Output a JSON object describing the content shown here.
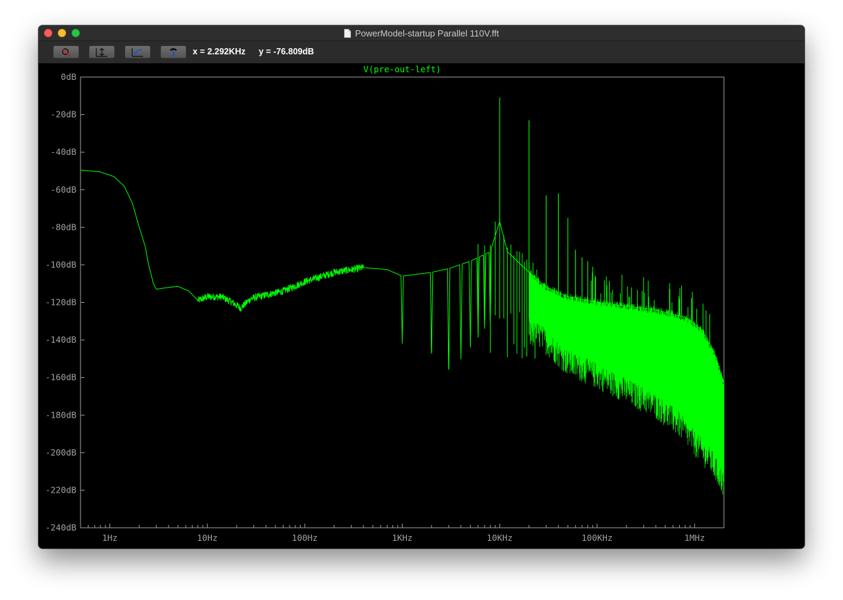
{
  "window": {
    "title": "PowerModel-startup Parallel 110V.fft"
  },
  "toolbar": {
    "buttons": [
      {
        "name": "zoom-cancel-button",
        "icon": "magnifier-cancel-icon"
      },
      {
        "name": "autorange-button",
        "icon": "autorange-icon"
      },
      {
        "name": "zoom-back-button",
        "icon": "zoom-back-icon"
      },
      {
        "name": "probe-button",
        "icon": "probe-icon"
      }
    ],
    "cursor_x": "x = 2.292KHz",
    "cursor_y": "y = -76.809dB"
  },
  "plot": {
    "trace_label": "V(pre-out-left)",
    "trace_color": "#00ff00",
    "axis_color": "#a0a0a0",
    "grid": false
  },
  "chart_data": {
    "type": "line",
    "title": "V(pre-out-left)",
    "xlabel": "",
    "ylabel": "",
    "x_scale": "log",
    "xlim": [
      0.5,
      2000000
    ],
    "ylim": [
      -240,
      0
    ],
    "x_ticks": [
      {
        "value": 1,
        "label": "1Hz"
      },
      {
        "value": 10,
        "label": "10Hz"
      },
      {
        "value": 100,
        "label": "100Hz"
      },
      {
        "value": 1000,
        "label": "1KHz"
      },
      {
        "value": 10000,
        "label": "10KHz"
      },
      {
        "value": 100000,
        "label": "100KHz"
      },
      {
        "value": 1000000,
        "label": "1MHz"
      }
    ],
    "y_ticks": [
      {
        "value": 0,
        "label": "0dB"
      },
      {
        "value": -20,
        "label": "-20dB"
      },
      {
        "value": -40,
        "label": "-40dB"
      },
      {
        "value": -60,
        "label": "-60dB"
      },
      {
        "value": -80,
        "label": "-80dB"
      },
      {
        "value": -100,
        "label": "-100dB"
      },
      {
        "value": -120,
        "label": "-120dB"
      },
      {
        "value": -140,
        "label": "-140dB"
      },
      {
        "value": -160,
        "label": "-160dB"
      },
      {
        "value": -180,
        "label": "-180dB"
      },
      {
        "value": -200,
        "label": "-200dB"
      },
      {
        "value": -220,
        "label": "-220dB"
      },
      {
        "value": -240,
        "label": "-240dB"
      }
    ],
    "series": [
      {
        "name": "V(pre-out-left)",
        "color": "#00ff00",
        "envelope": [
          [
            0.5,
            -49.5
          ],
          [
            0.8,
            -50.5
          ],
          [
            1.1,
            -53
          ],
          [
            1.4,
            -58
          ],
          [
            1.7,
            -67
          ],
          [
            2.0,
            -80
          ],
          [
            2.3,
            -90
          ],
          [
            2.5,
            -100
          ],
          [
            2.8,
            -110
          ],
          [
            3.0,
            -113
          ],
          [
            4.0,
            -112
          ],
          [
            5.0,
            -111.5
          ],
          [
            6.5,
            -114
          ],
          [
            8.0,
            -119
          ],
          [
            10,
            -117
          ],
          [
            14,
            -117
          ],
          [
            18,
            -120
          ],
          [
            22,
            -123
          ],
          [
            28,
            -118
          ],
          [
            40,
            -116
          ],
          [
            60,
            -114
          ],
          [
            100,
            -109
          ],
          [
            200,
            -104
          ],
          [
            400,
            -101.5
          ],
          [
            700,
            -102.5
          ],
          [
            1000,
            -106
          ],
          [
            2000,
            -104
          ],
          [
            3000,
            -102
          ],
          [
            5000,
            -98
          ],
          [
            8000,
            -93
          ],
          [
            10000,
            -77
          ],
          [
            12000,
            -93
          ],
          [
            20000,
            -104
          ],
          [
            30000,
            -112
          ],
          [
            50000,
            -117
          ],
          [
            100000,
            -120
          ],
          [
            200000,
            -122
          ],
          [
            400000,
            -124
          ],
          [
            800000,
            -128
          ],
          [
            1200000,
            -135
          ],
          [
            1600000,
            -147
          ],
          [
            2000000,
            -163
          ]
        ],
        "notches": [
          [
            1000,
            -142
          ],
          [
            2000,
            -152
          ],
          [
            3000,
            -162
          ],
          [
            4000,
            -152
          ],
          [
            5000,
            -145
          ],
          [
            6000,
            -140
          ],
          [
            7000,
            -136
          ],
          [
            8000,
            -133
          ]
        ],
        "spikes": [
          [
            10000,
            -11
          ],
          [
            20000,
            -23
          ],
          [
            30000,
            -63
          ],
          [
            40000,
            -62
          ],
          [
            50000,
            -75
          ],
          [
            60000,
            -92
          ],
          [
            70000,
            -96
          ],
          [
            80000,
            -98
          ],
          [
            90000,
            -101
          ]
        ],
        "noise_floor": [
          [
            25000,
            -140
          ],
          [
            50000,
            -155
          ],
          [
            100000,
            -162
          ],
          [
            200000,
            -170
          ],
          [
            400000,
            -178
          ],
          [
            700000,
            -188
          ],
          [
            1000000,
            -198
          ],
          [
            1500000,
            -208
          ],
          [
            2000000,
            -220
          ]
        ]
      }
    ]
  }
}
